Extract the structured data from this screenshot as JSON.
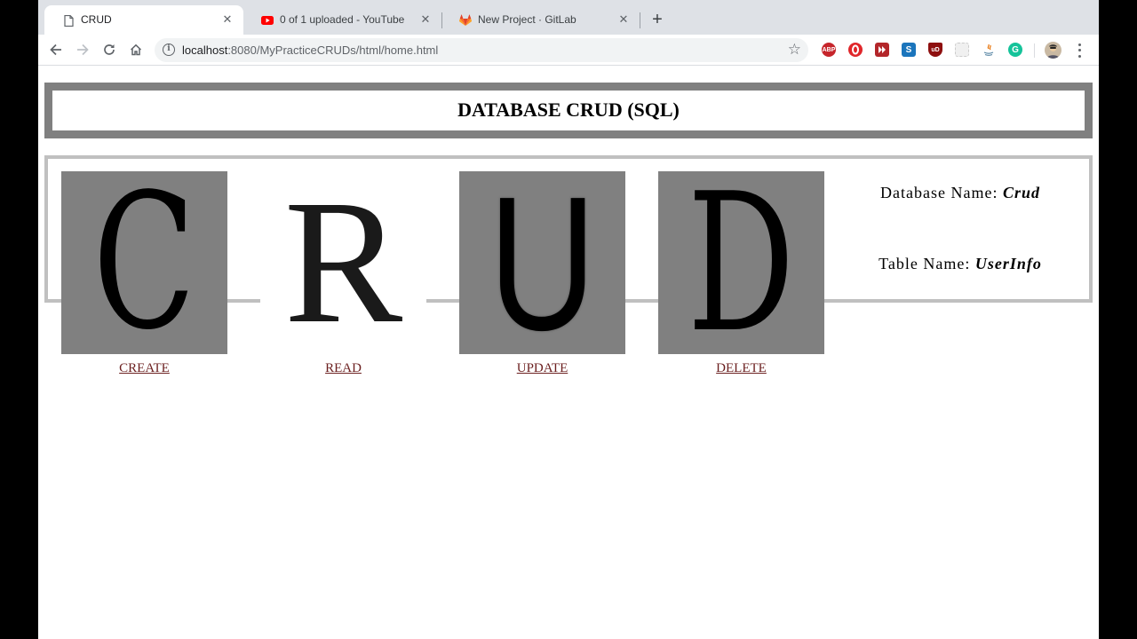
{
  "tabs": [
    {
      "title": "CRUD",
      "icon": "document-icon",
      "active": true
    },
    {
      "title": "0 of 1 uploaded - YouTube",
      "icon": "youtube-icon",
      "active": false
    },
    {
      "title": "New Project · GitLab",
      "icon": "gitlab-icon",
      "active": false
    }
  ],
  "toolbar": {
    "url_host": "localhost",
    "url_path": ":8080/MyPracticeCRUDs/html/home.html"
  },
  "extensions": [
    {
      "name": "adblock-icon",
      "label": "ABP",
      "color": "#c6252b"
    },
    {
      "name": "opera-icon",
      "label": "",
      "color": "#e0262a"
    },
    {
      "name": "skip-icon",
      "label": "",
      "color": "#b3262a"
    },
    {
      "name": "s-extension-icon",
      "label": "S",
      "color": "#1b75bc"
    },
    {
      "name": "ublock-icon",
      "label": "uD",
      "color": "#8e0f0f"
    },
    {
      "name": "blank-extension-icon",
      "label": "",
      "color": "#e8e8e8"
    },
    {
      "name": "java-icon",
      "label": "",
      "color": "#ffffff"
    },
    {
      "name": "grammarly-icon",
      "label": "G",
      "color": "#15c39a"
    }
  ],
  "page": {
    "heading": "DATABASE CRUD (SQL)",
    "cards": [
      {
        "letter": "C",
        "link": "CREATE"
      },
      {
        "letter": "R",
        "link": "READ"
      },
      {
        "letter": "U",
        "link": "UPDATE"
      },
      {
        "letter": "D",
        "link": "DELETE"
      }
    ],
    "db_label": "Database Name:",
    "db_value": "Crud",
    "table_label": "Table Name:",
    "table_value": "UserInfo"
  },
  "colors": {
    "header_border": "#808080",
    "main_border": "#c0c0c0",
    "tile_gray": "#808080",
    "link": "#6b1f1f"
  }
}
